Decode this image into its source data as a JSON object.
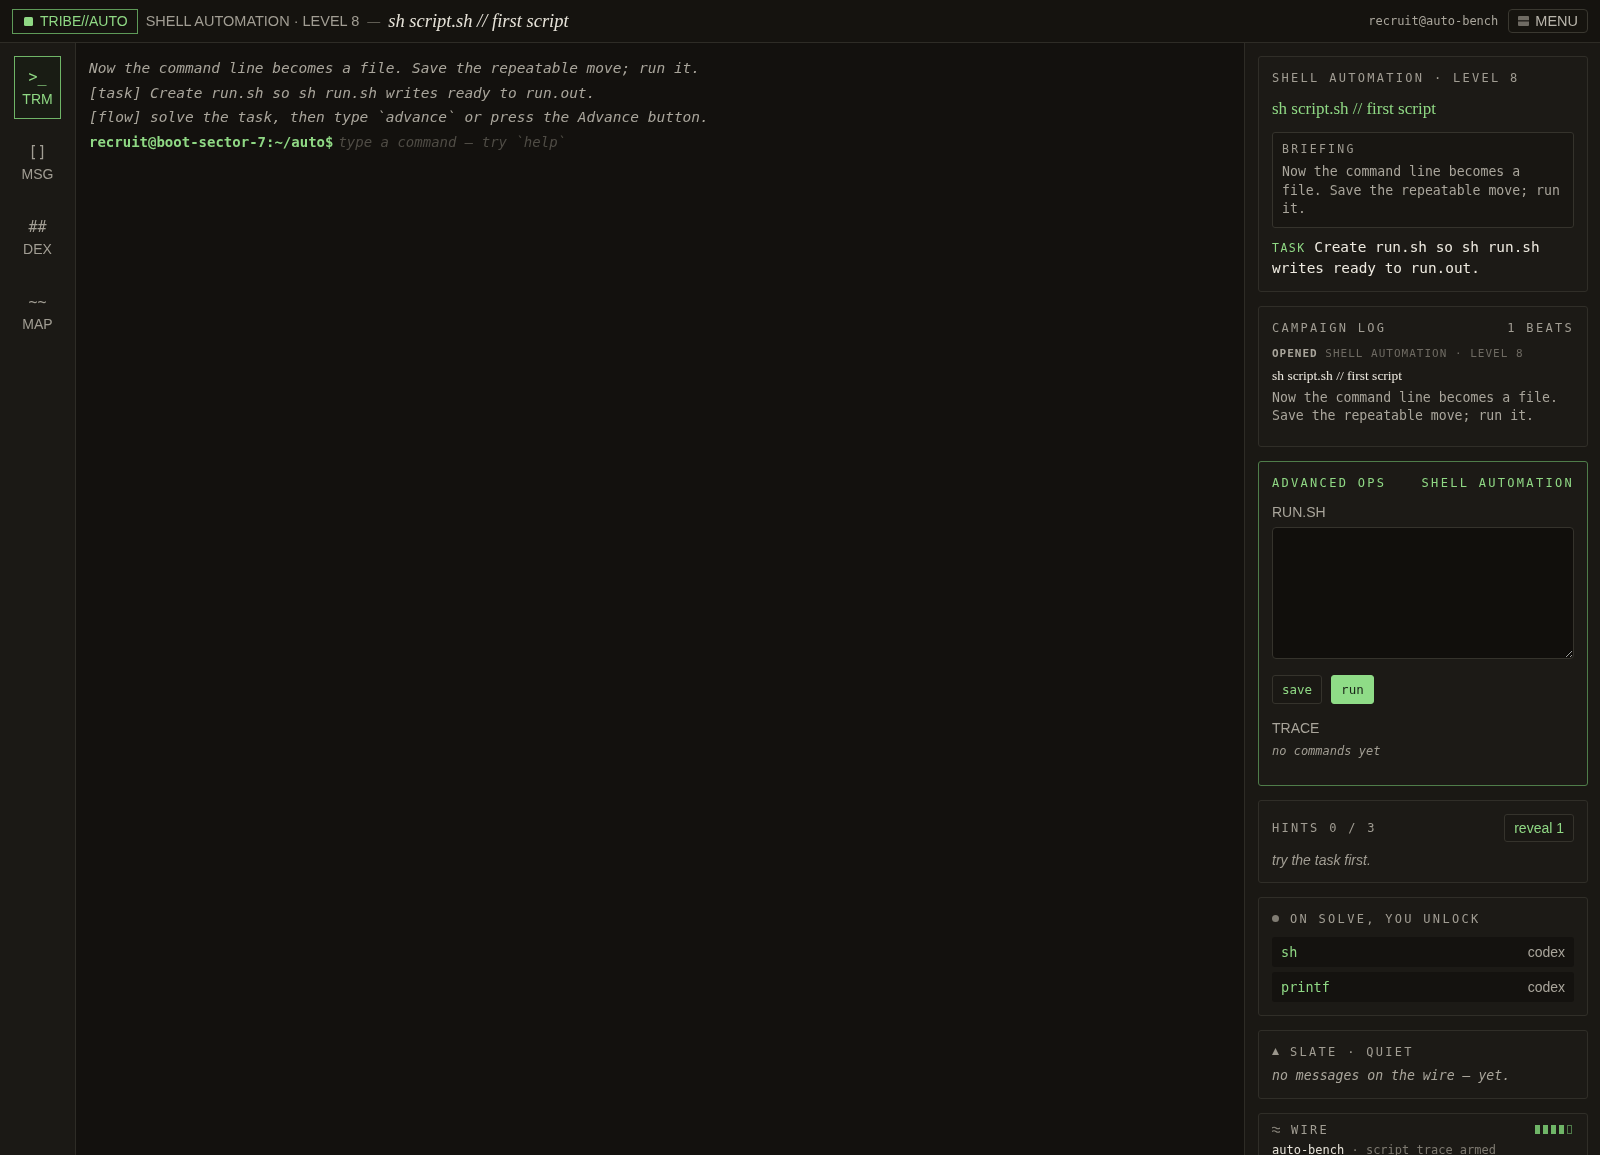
{
  "topbar": {
    "brand": "TRIBE//AUTO",
    "track": "SHELL AUTOMATION · LEVEL 8",
    "separator": "—",
    "title": "sh script.sh // first script",
    "user": "recruit@auto-bench",
    "menu_button": "MENU"
  },
  "sidebar": {
    "items": [
      {
        "glyph": ">_",
        "label": "TRM",
        "selected": true
      },
      {
        "glyph": "[]",
        "label": "MSG",
        "selected": false
      },
      {
        "glyph": "##",
        "label": "DEX",
        "selected": false
      },
      {
        "glyph": "~~",
        "label": "MAP",
        "selected": false
      }
    ]
  },
  "terminal": {
    "lines": [
      "Now the command line becomes a file. Save the repeatable move; run it.",
      "[task] Create run.sh so sh run.sh writes ready to run.out.",
      "[flow] solve the task, then type `advance` or press the Advance button."
    ],
    "prompt": "recruit@boot-sector-7:~/auto$",
    "placeholder": "type a command — try `help`"
  },
  "mission": {
    "track": "SHELL AUTOMATION · LEVEL 8",
    "title": "sh script.sh // first script",
    "briefing": {
      "heading": "BRIEFING",
      "text": "Now the command line becomes a file. Save the repeatable move; run it."
    },
    "task": "**TASK** Create run.sh so sh run.sh writes ready to run.out."
  },
  "campaign_log": {
    "heading": "CAMPAIGN LOG",
    "count": "1 BEATS",
    "entries": [
      {
        "meta": "**OPENED** SHELL AUTOMATION · LEVEL 8",
        "title": "sh script.sh // first script",
        "text": "Now the command line becomes a file. Save the repeatable move; run it."
      }
    ]
  },
  "advanced_ops": {
    "heading": "ADVANCED OPS",
    "track": "SHELL AUTOMATION",
    "file_label": "RUN.SH",
    "buttons": [
      {
        "label": "save",
        "kind": "secondary"
      },
      {
        "label": "run",
        "kind": "primary"
      }
    ],
    "trace": {
      "heading": "TRACE",
      "empty_text": "no commands yet"
    }
  },
  "hints": {
    "heading": "HINTS 0 / 3",
    "button": "reveal 1",
    "text": "try the task first."
  },
  "unlocks": {
    "heading": "ON SOLVE, YOU UNLOCK",
    "items": [
      {
        "name": "sh",
        "type": "codex"
      },
      {
        "name": "printf",
        "type": "codex"
      }
    ]
  },
  "slate": {
    "heading": "SLATE · QUIET",
    "text": "no messages on the wire — yet."
  },
  "wire": {
    "heading": "WIRE",
    "status": "**auto-bench** · script trace armed"
  }
}
